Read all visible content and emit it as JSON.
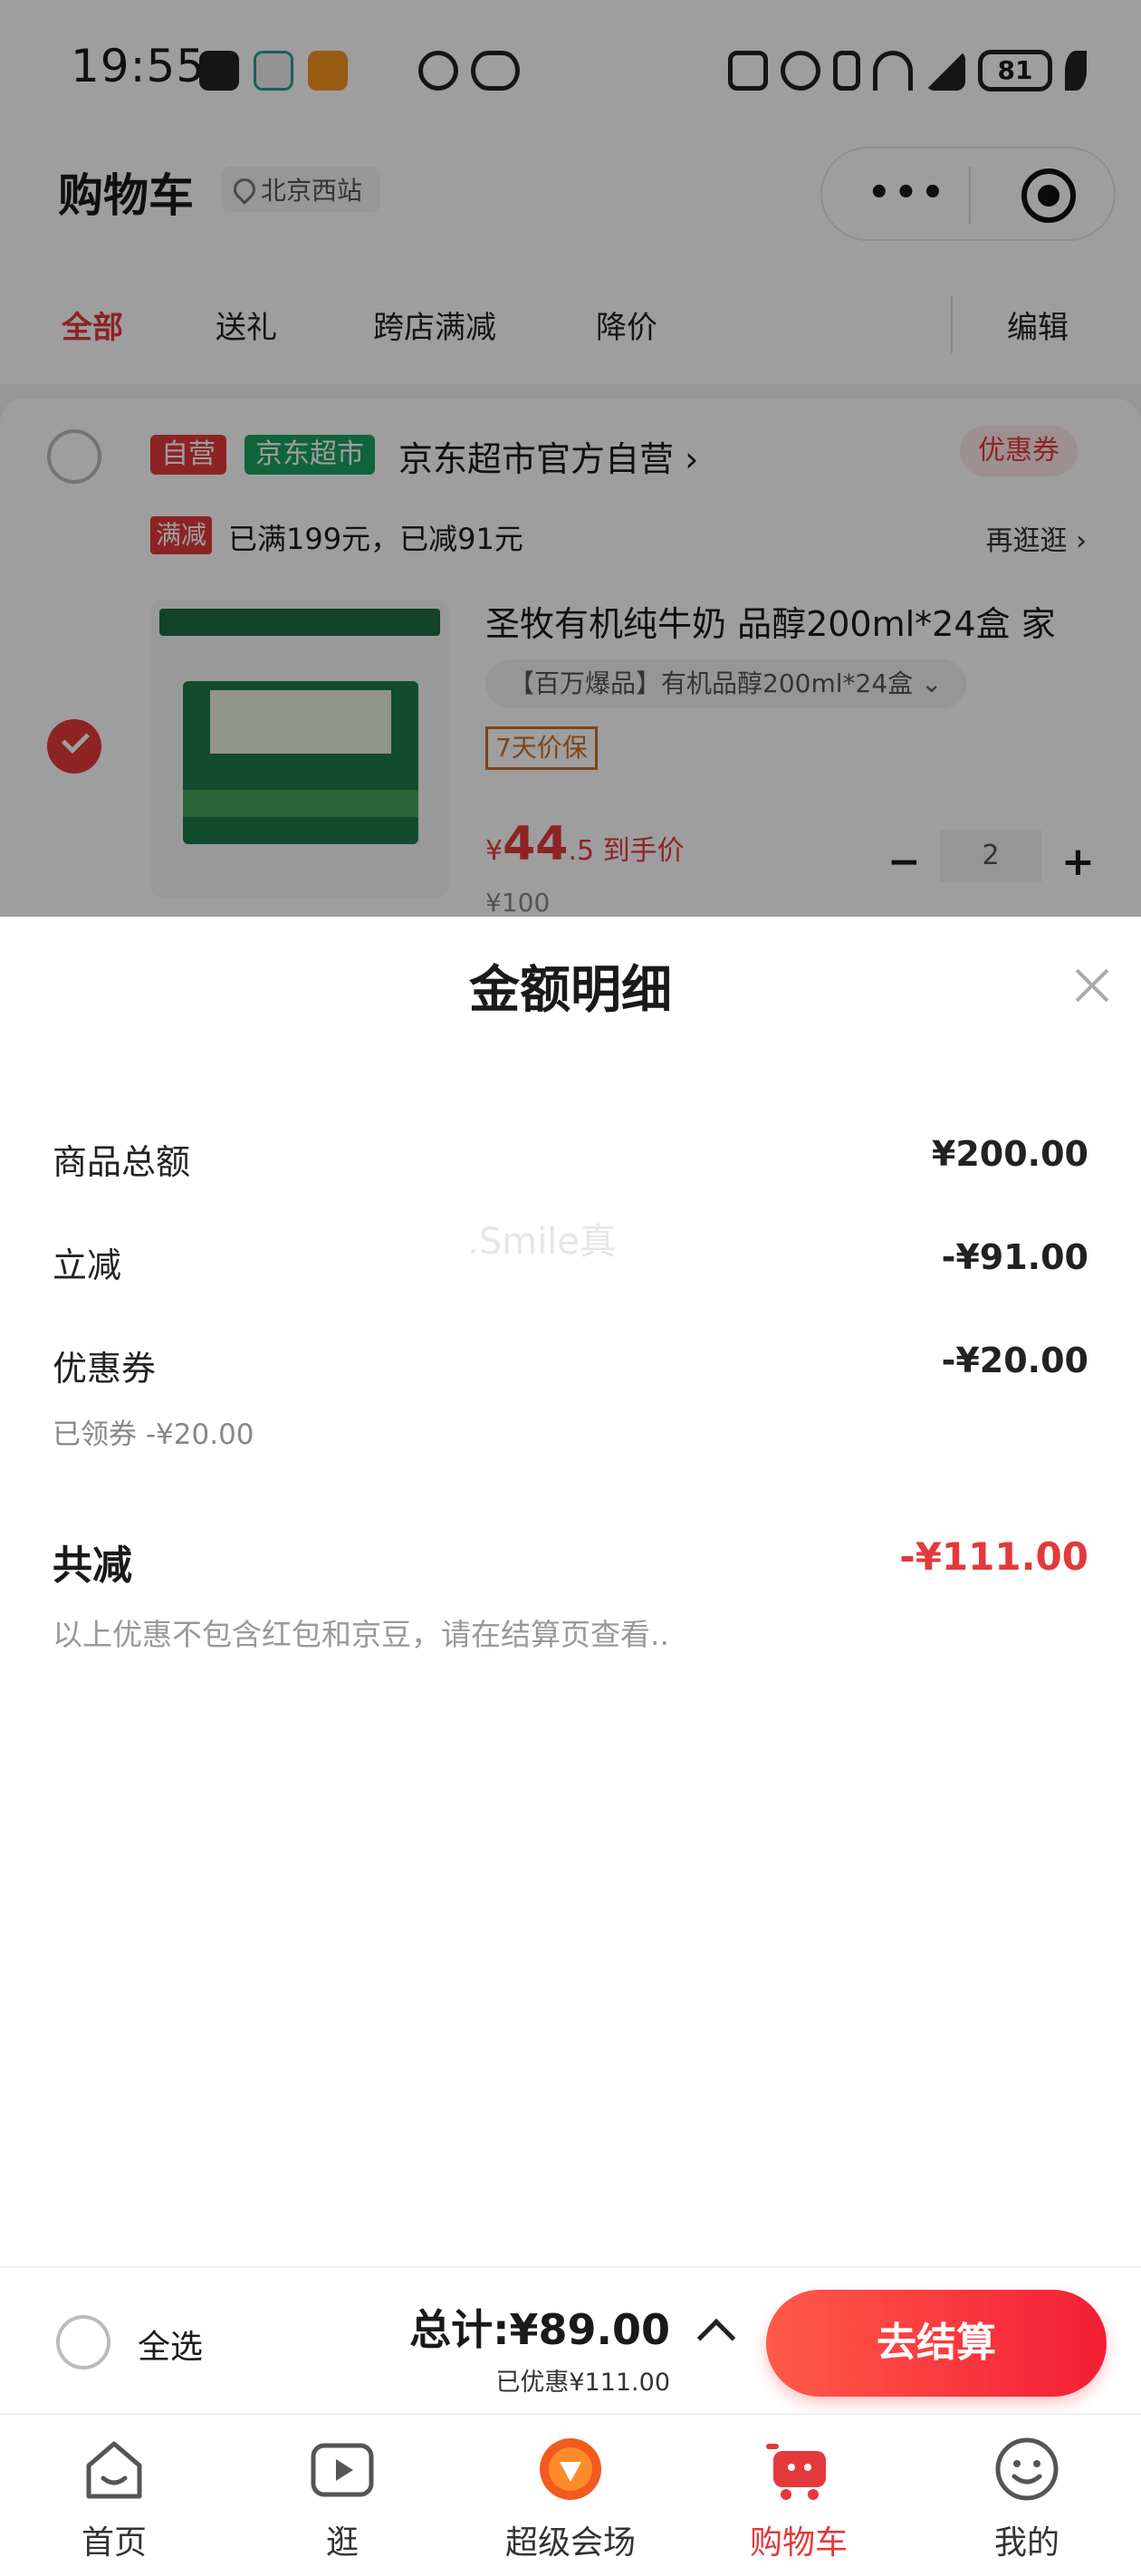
{
  "status_bar": {
    "time": "19:55",
    "battery": "81"
  },
  "header": {
    "title": "购物车",
    "location": "北京西站",
    "menu_dots": "•••"
  },
  "tabs": [
    {
      "label": "全部",
      "active": true
    },
    {
      "label": "送礼",
      "active": false
    },
    {
      "label": "跨店满减",
      "active": false
    },
    {
      "label": "降价",
      "active": false
    }
  ],
  "edit_label": "编辑",
  "store": {
    "tag_self": "自营",
    "tag_market": "京东超市",
    "name": "京东超市官方自营 ›",
    "coupon": "优惠券",
    "promo_tag": "满减",
    "promo_text": "已满199元，已减91元",
    "promo_link": "再逛逛 ›"
  },
  "product": {
    "title": "圣牧有机纯牛奶 品醇200ml*24盒 家",
    "variant": "【百万爆品】有机品醇200ml*24盒 ⌄",
    "badge": "7天价保",
    "price_symbol": "¥",
    "price_int": "44",
    "price_dec": ".5",
    "price_label": " 到手价",
    "quantity": "2",
    "orig_price": "¥100",
    "minus": "−",
    "plus": "+"
  },
  "sheet": {
    "title": "金额明细",
    "rows": [
      {
        "label": "商品总额",
        "value": "¥200.00"
      },
      {
        "label": "立减",
        "value": "-¥91.00"
      },
      {
        "label": "优惠券",
        "value": "-¥20.00",
        "sub": "已领券 -¥20.00"
      }
    ],
    "total_label": "共减",
    "total_value": "-¥111.00",
    "note": "以上优惠不包含红包和京豆，请在结算页查看..",
    "watermark": ".Smile真"
  },
  "checkout": {
    "select_all": "全选",
    "total": "总计:¥89.00",
    "discount": "已优惠¥111.00",
    "button": "去结算"
  },
  "tabbar": [
    {
      "label": "首页",
      "icon": "home-icon",
      "active": false
    },
    {
      "label": "逛",
      "icon": "video-icon",
      "active": false
    },
    {
      "label": "超级会场",
      "icon": "venue-icon",
      "active": false
    },
    {
      "label": "购物车",
      "icon": "cart-icon",
      "active": true
    },
    {
      "label": "我的",
      "icon": "profile-icon",
      "active": false
    }
  ],
  "colors": {
    "accent": "#e4393c",
    "market_green": "#1aa260",
    "price_badge": "#c8702a"
  }
}
